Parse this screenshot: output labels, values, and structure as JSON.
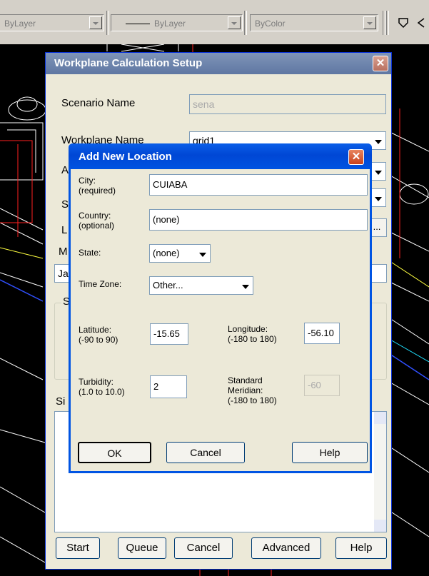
{
  "toolbar": {
    "layer_combo": "ByLayer",
    "linetype_combo": "ByLayer",
    "color_combo": "ByColor"
  },
  "setup_dialog": {
    "title": "Workplane Calculation Setup",
    "close_glyph": "✕",
    "scenario_label": "Scenario Name",
    "scenario_value": "sena",
    "workplane_label": "Workplane Name",
    "workplane_value": "grid1",
    "row3_label_partial": "A",
    "row4_label_partial": "S",
    "row5_label_partial": "L",
    "row5_button": "...",
    "row6_label_partial": "M",
    "row7_value_partial": "Ja",
    "group_label_partial": "S",
    "list_label_partial": "Si",
    "buttons": {
      "start": "Start",
      "queue": "Queue",
      "cancel": "Cancel",
      "advanced": "Advanced",
      "help": "Help"
    }
  },
  "location_dialog": {
    "title": "Add New Location",
    "close_glyph": "✕",
    "city_label": "City:",
    "city_hint": "(required)",
    "city_value": "CUIABA",
    "country_label": "Country:",
    "country_hint": "(optional)",
    "country_value": "(none)",
    "state_label": "State:",
    "state_value": "(none)",
    "timezone_label": "Time Zone:",
    "timezone_value": "Other...",
    "latitude_label": "Latitude:",
    "latitude_hint": "(-90 to 90)",
    "latitude_value": "-15.65",
    "longitude_label": "Longitude:",
    "longitude_hint": "(-180 to 180)",
    "longitude_value": "-56.10",
    "turbidity_label": "Turbidity:",
    "turbidity_hint": "(1.0 to 10.0)",
    "turbidity_value": "2",
    "meridian_label_1": "Standard",
    "meridian_label_2": "Meridian:",
    "meridian_hint": "(-180 to 180)",
    "meridian_value": "-60",
    "ok": "OK",
    "cancel": "Cancel",
    "help": "Help"
  }
}
